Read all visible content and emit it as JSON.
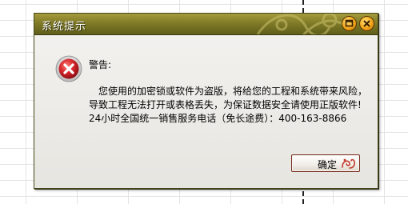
{
  "dialog": {
    "title": "系统提示",
    "heading": "警告:",
    "message_lines": [
      "您使用的加密锁或软件为盗版，将给您的工程和系统带来风险，",
      "导致工程无法打开或表格丢失，为保证数据安全请使用正版软件!",
      "24小时全国统一销售服务电话（免长途费）：400-163-8866"
    ],
    "ok_label": "确定",
    "icons": {
      "error": "error-x-icon",
      "maximize": "maximize-icon",
      "close": "close-icon"
    },
    "colors": {
      "titlebar": "#7d7826",
      "button_orange": "#f2a51a",
      "error_red": "#d4252b"
    }
  }
}
